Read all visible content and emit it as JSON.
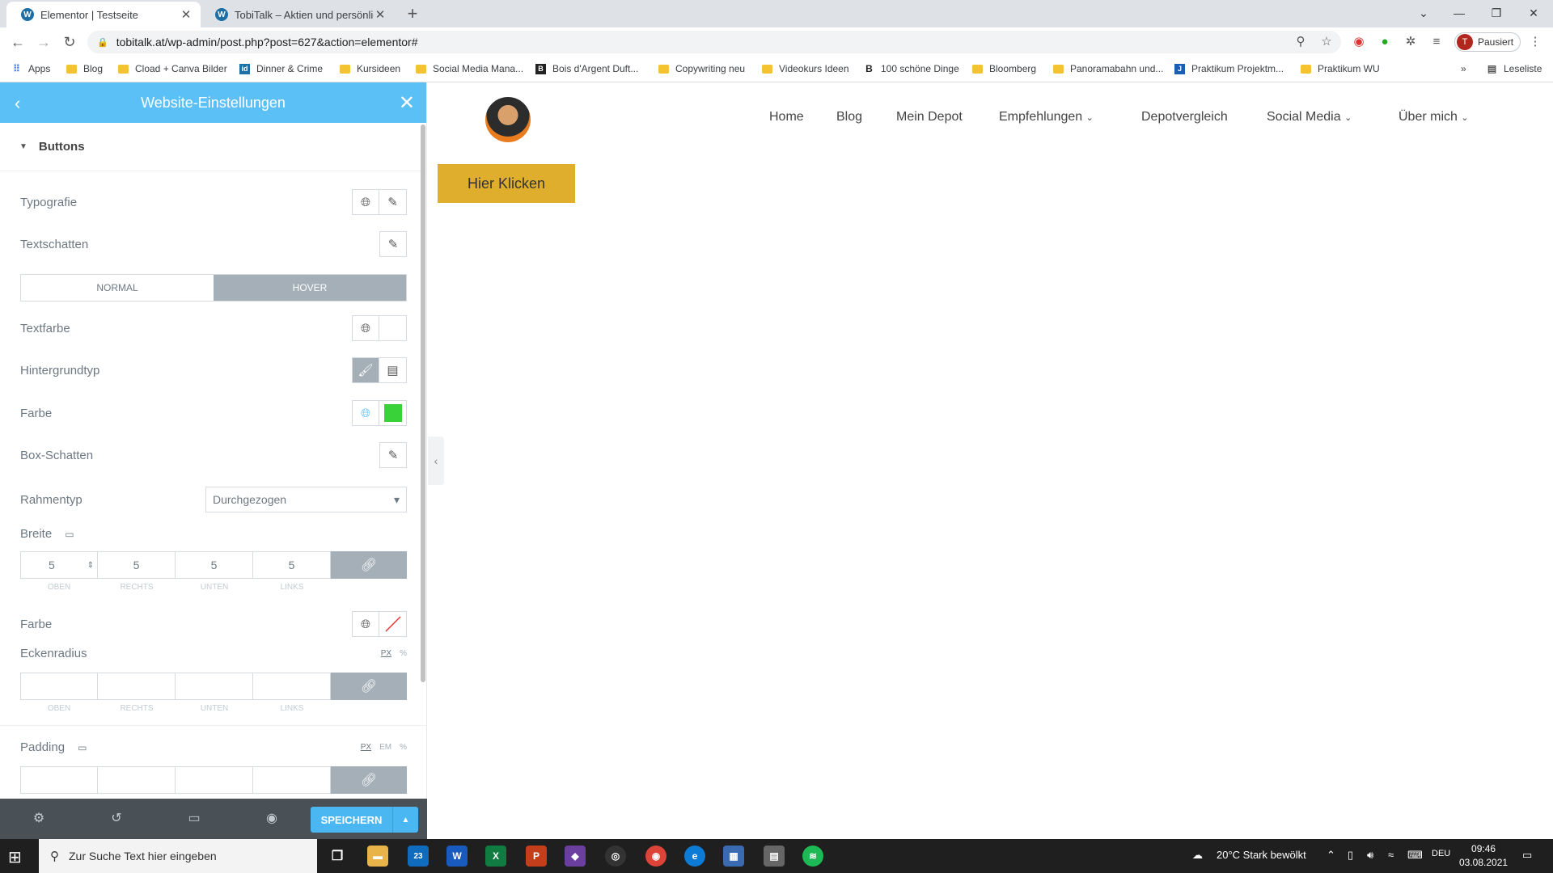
{
  "browser": {
    "tabs": [
      {
        "title": "Elementor | Testseite",
        "active": true
      },
      {
        "title": "TobiTalk – Aktien und persönlich",
        "active": false
      }
    ],
    "url": "tobitalk.at/wp-admin/post.php?post=627&action=elementor#",
    "profile_label": "Pausiert",
    "profile_initial": "T",
    "bookmarks": [
      "Apps",
      "Blog",
      "Cload + Canva Bilder",
      "Dinner & Crime",
      "Kursideen",
      "Social Media Mana...",
      "Bois d'Argent Duft...",
      "Copywriting neu",
      "Videokurs Ideen",
      "100 schöne Dinge",
      "Bloomberg",
      "Panoramabahn und...",
      "Praktikum Projektm...",
      "Praktikum WU"
    ],
    "reading_list": "Leseliste"
  },
  "panel": {
    "title": "Website-Einstellungen",
    "section_title": "Buttons",
    "typography_label": "Typografie",
    "textshadow_label": "Textschatten",
    "tabs": {
      "normal": "NORMAL",
      "hover": "HOVER"
    },
    "textcolor_label": "Textfarbe",
    "bgtype_label": "Hintergrundtyp",
    "color_label": "Farbe",
    "color_swatch": "#39d239",
    "boxshadow_label": "Box-Schatten",
    "border_type_label": "Rahmentyp",
    "border_type_value": "Durchgezogen",
    "width_label": "Breite",
    "width_values": [
      "5",
      "5",
      "5",
      "5"
    ],
    "dim_labels": [
      "OBEN",
      "RECHTS",
      "UNTEN",
      "LINKS"
    ],
    "border_color_label": "Farbe",
    "radius_label": "Eckenradius",
    "radius_units": [
      "PX",
      "%"
    ],
    "padding_label": "Padding",
    "padding_units": [
      "PX",
      "EM",
      "%"
    ],
    "save_label": "SPEICHERN"
  },
  "site": {
    "nav": [
      "Home",
      "Blog",
      "Mein Depot",
      "Empfehlungen",
      "Depotvergleich",
      "Social Media",
      "Über mich"
    ],
    "button_label": "Hier Klicken",
    "button_color": "#dfae2c"
  },
  "taskbar": {
    "search_placeholder": "Zur Suche Text hier eingeben",
    "weather": "20°C  Stark bewölkt",
    "lang": "DEU",
    "time": "09:46",
    "date": "03.08.2021",
    "mail_badge": "23"
  }
}
